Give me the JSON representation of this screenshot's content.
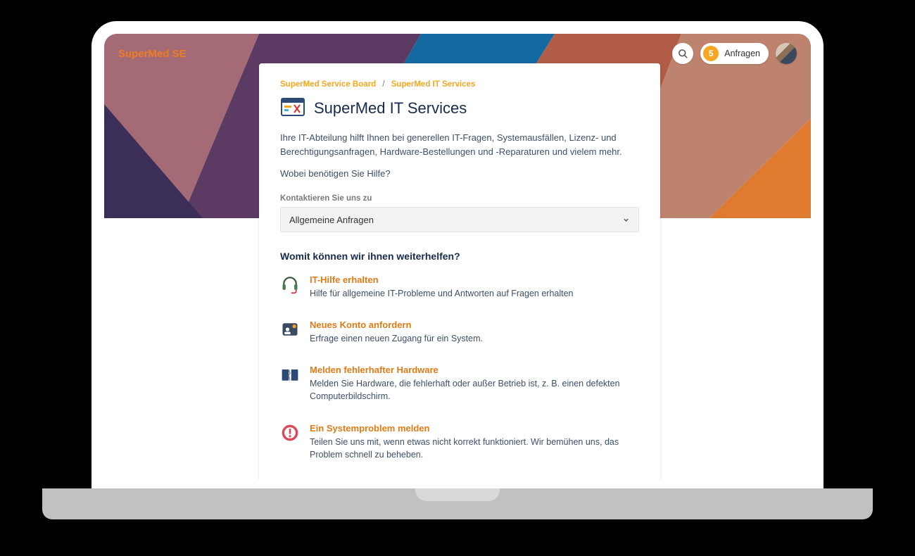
{
  "header": {
    "brand": "SuperMed SE",
    "requests_count": "5",
    "requests_label": "Anfragen"
  },
  "breadcrumb": {
    "parent": "SuperMed Service Board",
    "current": "SuperMed IT Services"
  },
  "page": {
    "title": "SuperMed IT Services",
    "description": "Ihre IT-Abteilung hilft Ihnen bei generellen IT-Fragen, Systemausfällen, Lizenz- und Berechtigungsanfragen, Hardware-Bestellungen und -Reparaturen und vielem mehr.",
    "help_prompt": "Wobei benötigen Sie Hilfe?"
  },
  "contact_select": {
    "label": "Kontaktieren Sie uns zu",
    "value": "Allgemeine Anfragen"
  },
  "section_title": "Womit können wir ihnen weiterhelfen?",
  "services": [
    {
      "title": "IT-Hilfe erhalten",
      "desc": "Hilfe für allgemeine IT-Probleme und Antworten auf Fragen erhalten"
    },
    {
      "title": "Neues Konto anfordern",
      "desc": "Erfrage einen neuen Zugang für ein System."
    },
    {
      "title": "Melden fehlerhafter Hardware",
      "desc": "Melden Sie Hardware, die fehlerhaft oder außer Betrieb ist, z. B. einen defekten Computerbildschirm."
    },
    {
      "title": "Ein Systemproblem melden",
      "desc": "Teilen Sie uns mit, wenn etwas nicht korrekt funktioniert. Wir bemühen uns, das Problem schnell zu beheben."
    }
  ]
}
